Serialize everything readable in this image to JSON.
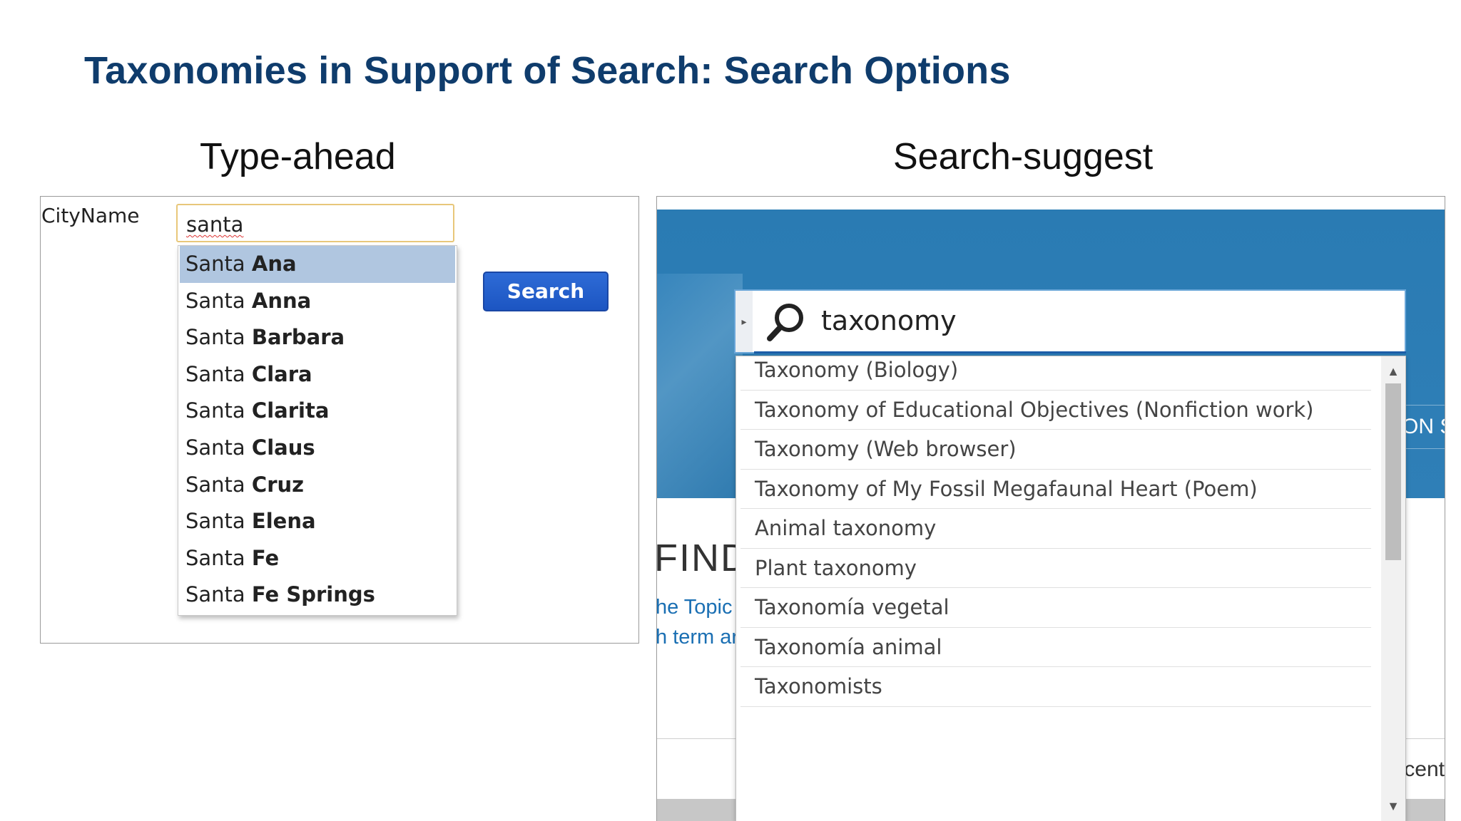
{
  "slide": {
    "title": "Taxonomies in Support of Search: Search Options",
    "left_heading": "Type-ahead",
    "right_heading": "Search-suggest"
  },
  "type_ahead": {
    "field_label": "CityName",
    "input_value": "santa",
    "search_button": "Search",
    "suggestions": [
      {
        "prefix": "Santa ",
        "rest": "Ana",
        "selected": true
      },
      {
        "prefix": "Santa ",
        "rest": "Anna"
      },
      {
        "prefix": "Santa ",
        "rest": "Barbara"
      },
      {
        "prefix": "Santa ",
        "rest": "Clara"
      },
      {
        "prefix": "Santa ",
        "rest": "Clarita"
      },
      {
        "prefix": "Santa ",
        "rest": "Claus"
      },
      {
        "prefix": "Santa ",
        "rest": "Cruz"
      },
      {
        "prefix": "Santa ",
        "rest": "Elena"
      },
      {
        "prefix": "Santa ",
        "rest": "Fe"
      },
      {
        "prefix": "Santa ",
        "rest": "Fe Springs"
      }
    ]
  },
  "search_suggest": {
    "query": "taxonomy",
    "background_text": {
      "banner_fragment": "ON S",
      "find": "FIND",
      "link1": "he Topic I",
      "link2": "h term ar",
      "recent": "ecent"
    },
    "suggestions": [
      "Taxonomy (Biology)",
      "Taxonomy of Educational Objectives (Nonfiction work)",
      "Taxonomy (Web browser)",
      "Taxonomy of My Fossil Megafaunal Heart (Poem)",
      "Animal taxonomy",
      "Plant taxonomy",
      "Taxonomía vegetal",
      "Taxonomía animal",
      "Taxonomists"
    ]
  },
  "colors": {
    "title": "#0f3c6c",
    "selected_row": "#b0c6e0",
    "search_button": "#1c55c2",
    "banner": "#2a7bb3"
  },
  "icons": [
    "search-icon",
    "expand-arrow-icon",
    "scroll-up-icon",
    "scroll-down-icon"
  ]
}
